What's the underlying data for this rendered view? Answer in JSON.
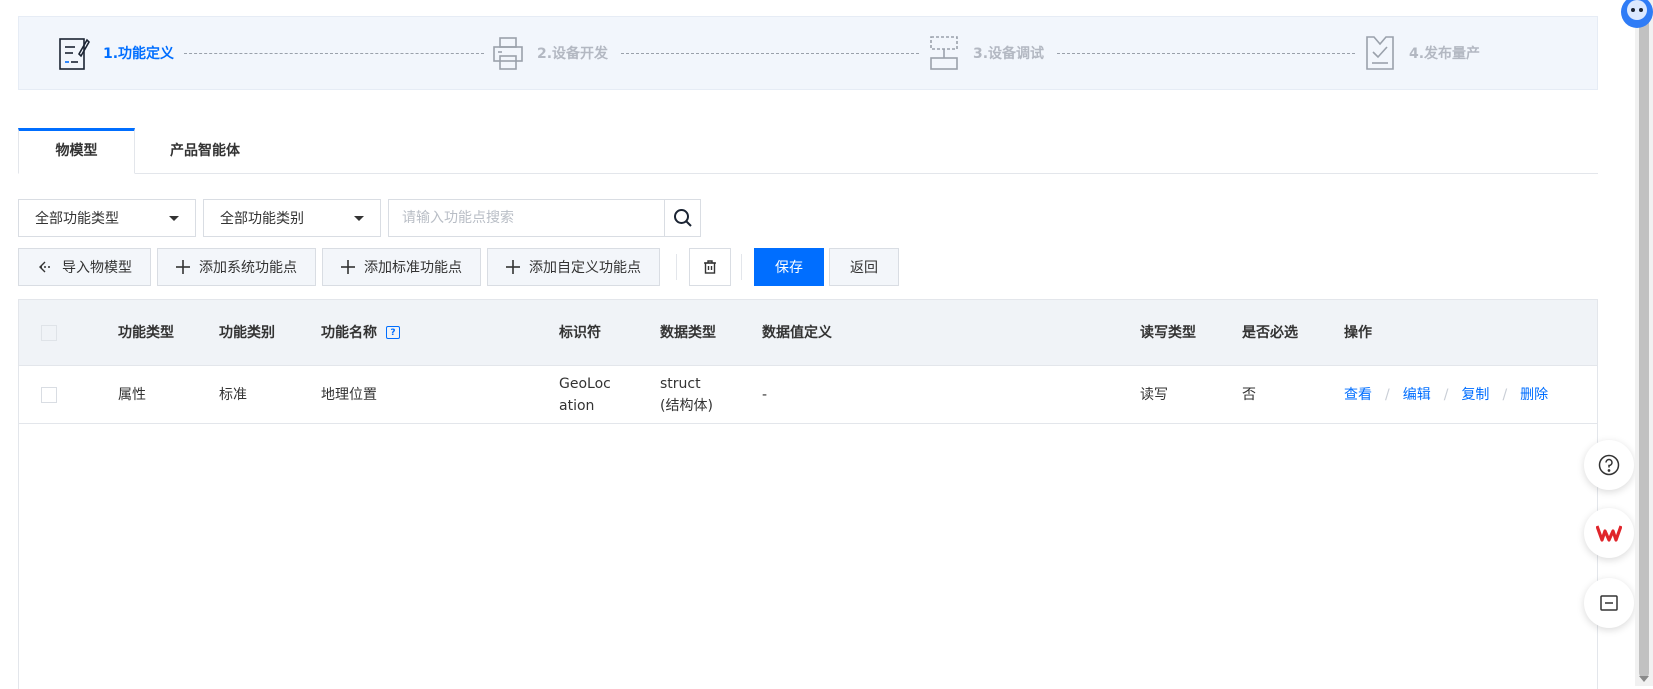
{
  "stepper": {
    "steps": [
      {
        "label": "1.功能定义",
        "icon": "document-edit-icon",
        "active": true
      },
      {
        "label": "2.设备开发",
        "icon": "printer-icon",
        "active": false
      },
      {
        "label": "3.设备调试",
        "icon": "debug-icon",
        "active": false
      },
      {
        "label": "4.发布量产",
        "icon": "clipboard-check-icon",
        "active": false
      }
    ],
    "colors": {
      "active": "#006eff",
      "inactive": "#b3b8c2"
    }
  },
  "tabs": [
    {
      "label": "物模型",
      "active": true
    },
    {
      "label": "产品智能体",
      "active": false
    }
  ],
  "filters": {
    "type_select": "全部功能类型",
    "category_select": "全部功能类别",
    "search_placeholder": "请输入功能点搜索"
  },
  "toolbar": {
    "import_label": "导入物模型",
    "add_system_label": "添加系统功能点",
    "add_standard_label": "添加标准功能点",
    "add_custom_label": "添加自定义功能点",
    "save_label": "保存",
    "back_label": "返回"
  },
  "table": {
    "headers": {
      "func_type": "功能类型",
      "func_category": "功能类别",
      "func_name": "功能名称",
      "identifier": "标识符",
      "data_type": "数据类型",
      "data_def": "数据值定义",
      "rw_type": "读写类型",
      "required": "是否必选",
      "ops": "操作"
    },
    "rows": [
      {
        "func_type": "属性",
        "func_category": "标准",
        "func_name": "地理位置",
        "identifier": "GeoLocation",
        "data_type": "struct (结构体)",
        "data_def": "-",
        "rw_type": "读写",
        "required": "否",
        "ops": [
          "查看",
          "编辑",
          "复制",
          "删除"
        ]
      }
    ]
  },
  "accent_color": "#006eff"
}
